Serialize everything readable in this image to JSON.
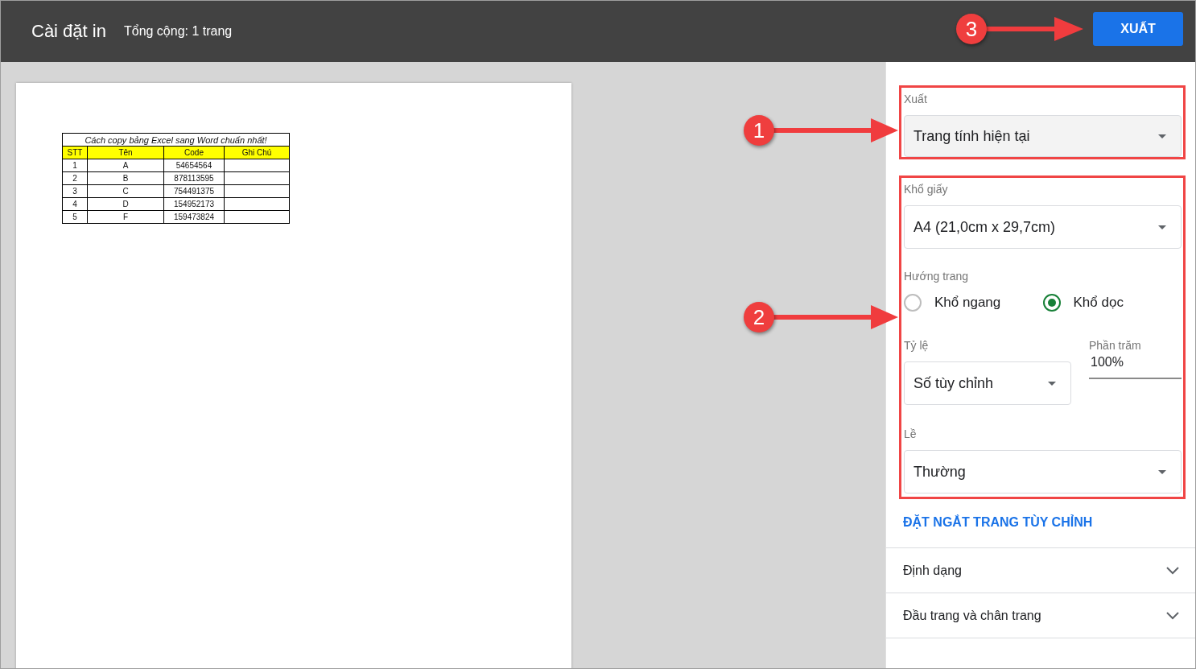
{
  "header": {
    "title": "Cài đặt in",
    "subtitle": "Tổng cộng: 1 trang",
    "export_button": "XUẤT",
    "callout": "3"
  },
  "preview": {
    "table": {
      "title": "Cách copy bảng Excel sang Word chuẩn nhất!",
      "columns": [
        "STT",
        "Tên",
        "Code",
        "Ghi Chú"
      ],
      "rows": [
        [
          "1",
          "A",
          "54654564",
          ""
        ],
        [
          "2",
          "B",
          "878113595",
          ""
        ],
        [
          "3",
          "C",
          "754491375",
          ""
        ],
        [
          "4",
          "D",
          "154952173",
          ""
        ],
        [
          "5",
          "F",
          "159473824",
          ""
        ]
      ]
    }
  },
  "panel": {
    "export_group": {
      "highlighted": true,
      "callout": "1",
      "label": "Xuất",
      "value": "Trang tính hiện tại"
    },
    "page_group": {
      "highlighted": true,
      "callout": "2",
      "paper_size": {
        "label": "Khổ giấy",
        "value": "A4 (21,0cm x 29,7cm)"
      },
      "orientation": {
        "label": "Hướng trang",
        "options": [
          {
            "label": "Khổ ngang",
            "selected": false
          },
          {
            "label": "Khổ dọc",
            "selected": true
          }
        ]
      },
      "scale": {
        "label": "Tỷ lệ",
        "value": "Số tùy chỉnh",
        "percent_label": "Phần trăm",
        "percent_value": "100%"
      },
      "margins": {
        "label": "Lề",
        "value": "Thường"
      }
    },
    "link": "ĐẶT NGẮT TRANG TÙY CHỈNH",
    "sections": [
      {
        "label": "Định dạng",
        "expanded": false
      },
      {
        "label": "Đầu trang và chân trang",
        "expanded": false
      }
    ]
  }
}
